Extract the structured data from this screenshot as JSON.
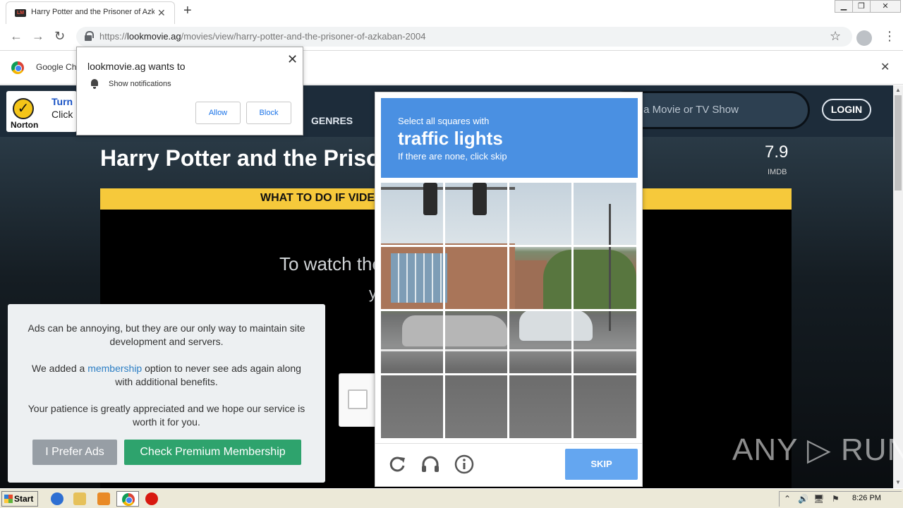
{
  "browser": {
    "tab_title": "Harry Potter and the Prisoner of Azkaban",
    "tab_favicon_text": "LM",
    "url_scheme": "https://",
    "url_host": "lookmovie.ag",
    "url_path": "/movies/view/harry-potter-and-the-prisoner-of-azkaban-2004",
    "infobar_text": "Google Ch"
  },
  "notification": {
    "title": "lookmovie.ag wants to",
    "permission": "Show notifications",
    "allow_label": "Allow",
    "block_label": "Block"
  },
  "site": {
    "norton_line1": "Turn",
    "norton_line2": "Click",
    "norton_brand": "Norton",
    "nav_genres": "GENRES",
    "search_placeholder": "r a Movie or TV Show",
    "login_label": "LOGIN"
  },
  "movie": {
    "title": "Harry Potter and the Prisoner of Azkaban",
    "rating": "7.9",
    "rating_source": "IMDB",
    "banner": "WHAT TO DO IF VIDEO",
    "watch_text": "To watch the",
    "watch_text2": "y"
  },
  "ad_dialog": {
    "p1": "Ads can be annoying, but they are our only way to maintain site development and servers.",
    "p2_before": "We added a ",
    "p2_link": "membership",
    "p2_after": " option to never see ads again along with additional benefits.",
    "p3": "Your patience is greatly appreciated and we hope our service is worth it for you.",
    "prefer_ads_label": "I Prefer Ads",
    "premium_label": "Check Premium Membership"
  },
  "captcha": {
    "instruction": "Select all squares with",
    "target": "traffic lights",
    "hint": "If there are none, click skip",
    "skip_label": "SKIP"
  },
  "watermark": "ANY ▷ RUN",
  "taskbar": {
    "start_label": "Start",
    "clock": "8:26 PM"
  },
  "colors": {
    "captcha_blue": "#4a90e2",
    "skip_blue": "#64a6f0",
    "premium_green": "#2ea36d",
    "banner_yellow": "#f6c93b",
    "site_header": "#1d2c3a"
  }
}
